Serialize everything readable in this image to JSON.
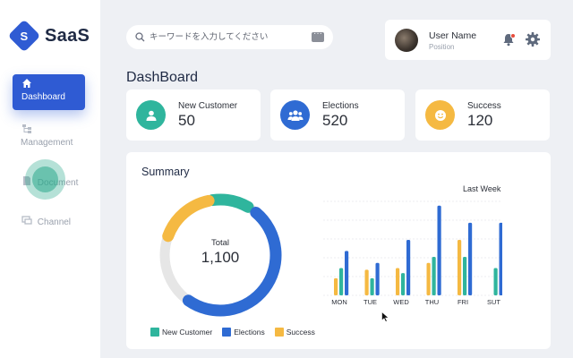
{
  "app": {
    "name": "SaaS",
    "logo_letter": "S"
  },
  "sidebar": {
    "items": [
      {
        "label": "Dashboard",
        "icon": "home-icon",
        "active": true
      },
      {
        "label": "Management",
        "icon": "hierarchy-icon",
        "active": false
      },
      {
        "label": "Document",
        "icon": "document-icon",
        "active": false
      },
      {
        "label": "Channel",
        "icon": "channel-icon",
        "active": false
      }
    ]
  },
  "search": {
    "placeholder": "キーワードを入力してください",
    "icon": "search-icon",
    "action_icon": "keyboard-icon"
  },
  "user": {
    "name": "User Name",
    "position": "Position",
    "icons": [
      "bell-icon",
      "gear-icon"
    ]
  },
  "page": {
    "title": "DashBoard"
  },
  "stats": [
    {
      "label": "New Customer",
      "value": "50",
      "color": "#2fb59d",
      "icon": "user-icon"
    },
    {
      "label": "Elections",
      "value": "520",
      "color": "#2f6bd3",
      "icon": "group-icon"
    },
    {
      "label": "Success",
      "value": "120",
      "color": "#f5b942",
      "icon": "smile-icon"
    }
  ],
  "summary": {
    "title": "Summary",
    "total_label": "Total",
    "total_value": "1,100",
    "period_label": "Last Week"
  },
  "chart_data": [
    {
      "type": "pie",
      "categories": [
        "New Customer",
        "Elections",
        "Success"
      ],
      "values": [
        50,
        520,
        120
      ],
      "colors": [
        "#2fb59d",
        "#2f6bd3",
        "#f5b942"
      ],
      "remainder_color": "#e6e6e6"
    },
    {
      "type": "bar",
      "categories": [
        "MON",
        "TUE",
        "WED",
        "THU",
        "FRI",
        "SUT"
      ],
      "series": [
        {
          "name": "Success",
          "color": "#f5b942",
          "values": [
            2,
            3,
            3.2,
            3.8,
            6.5,
            0
          ]
        },
        {
          "name": "New Customer",
          "color": "#2fb59d",
          "values": [
            3.2,
            2,
            2.6,
            4.5,
            4.5,
            3.2
          ]
        },
        {
          "name": "Elections",
          "color": "#2f6bd3",
          "values": [
            5.2,
            3.8,
            6.5,
            10.5,
            8.5,
            8.5
          ]
        }
      ],
      "ylim": [
        0,
        11
      ],
      "grid": true
    }
  ],
  "legend": [
    {
      "label": "New Customer",
      "color": "#2fb59d"
    },
    {
      "label": "Elections",
      "color": "#2f6bd3"
    },
    {
      "label": "Success",
      "color": "#f5b942"
    }
  ]
}
